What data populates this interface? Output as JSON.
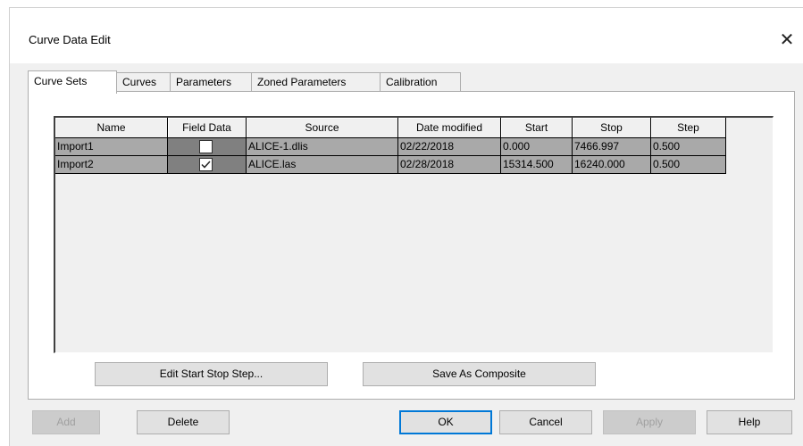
{
  "window": {
    "title": "Curve Data Edit",
    "close_glyph": "✕"
  },
  "tabs": [
    {
      "label": "Curve Sets",
      "active": true
    },
    {
      "label": "Curves",
      "active": false
    },
    {
      "label": "Parameters",
      "active": false
    },
    {
      "label": "Zoned Parameters",
      "active": false
    },
    {
      "label": "Calibration",
      "active": false
    }
  ],
  "table": {
    "columns": [
      "Name",
      "Field Data",
      "Source",
      "Date modified",
      "Start",
      "Stop",
      "Step"
    ],
    "rows": [
      {
        "name": "Import1",
        "field_data": false,
        "source": "ALICE-1.dlis",
        "date_modified": "02/22/2018",
        "start": "0.000",
        "stop": "7466.997",
        "step": "0.500"
      },
      {
        "name": "Import2",
        "field_data": true,
        "source": "ALICE.las",
        "date_modified": "02/28/2018",
        "start": "15314.500",
        "stop": "16240.000",
        "step": "0.500"
      }
    ]
  },
  "panel_buttons": {
    "edit_start_stop_step": "Edit Start Stop Step...",
    "save_as_composite": "Save As Composite"
  },
  "footer_buttons": {
    "add": "Add",
    "delete": "Delete",
    "ok": "OK",
    "cancel": "Cancel",
    "apply": "Apply",
    "help": "Help"
  },
  "colors": {
    "row_bg": "#a9a9a9",
    "checkbox_col_bg": "#808080",
    "default_button_border": "#0078d7"
  }
}
